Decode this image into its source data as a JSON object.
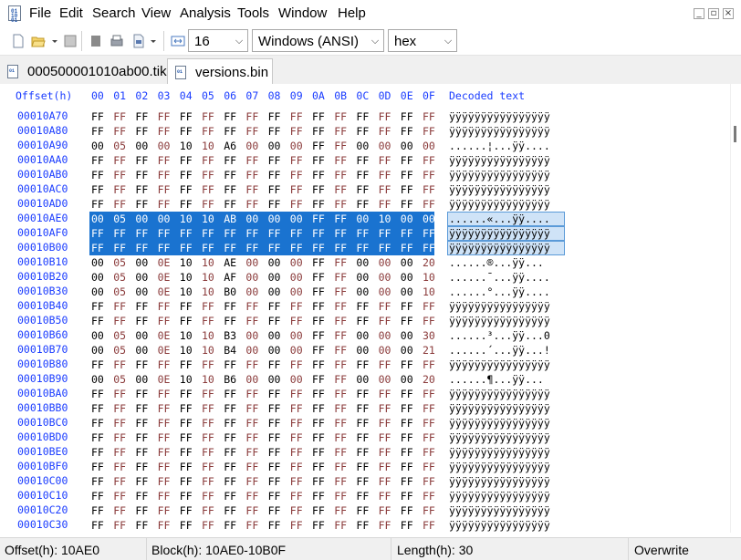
{
  "menu": [
    "File",
    "Edit",
    "Search",
    "View",
    "Analysis",
    "Tools",
    "Window",
    "Help"
  ],
  "toolbar": {
    "columns": "16",
    "charset": "Windows (ANSI)",
    "mode": "hex",
    "icons": [
      "new-file-icon",
      "open-folder-icon",
      "dropdown-arrow-icon",
      "save-icon",
      "save-all-icon",
      "print-icon",
      "export-icon",
      "dropdown-arrow-icon",
      "columns-icon"
    ]
  },
  "tabs": [
    {
      "label": "000500001010ab00.tik",
      "active": false
    },
    {
      "label": "versions.bin",
      "active": true
    }
  ],
  "header": {
    "offset": "Offset(h)",
    "cols": [
      "00",
      "01",
      "02",
      "03",
      "04",
      "05",
      "06",
      "07",
      "08",
      "09",
      "0A",
      "0B",
      "0C",
      "0D",
      "0E",
      "0F"
    ],
    "decoded": "Decoded text"
  },
  "rows": [
    {
      "offset": "00010A70",
      "bytes": "FF FF FF FF FF FF FF FF FF FF FF FF FF FF FF FF",
      "text": "ÿÿÿÿÿÿÿÿÿÿÿÿÿÿÿÿ"
    },
    {
      "offset": "00010A80",
      "bytes": "FF FF FF FF FF FF FF FF FF FF FF FF FF FF FF FF",
      "text": "ÿÿÿÿÿÿÿÿÿÿÿÿÿÿÿÿ"
    },
    {
      "offset": "00010A90",
      "bytes": "00 05 00 00 10 10 A6 00 00 00 FF FF 00 00 00 00",
      "text": "......¦...ÿÿ...."
    },
    {
      "offset": "00010AA0",
      "bytes": "FF FF FF FF FF FF FF FF FF FF FF FF FF FF FF FF",
      "text": "ÿÿÿÿÿÿÿÿÿÿÿÿÿÿÿÿ"
    },
    {
      "offset": "00010AB0",
      "bytes": "FF FF FF FF FF FF FF FF FF FF FF FF FF FF FF FF",
      "text": "ÿÿÿÿÿÿÿÿÿÿÿÿÿÿÿÿ"
    },
    {
      "offset": "00010AC0",
      "bytes": "FF FF FF FF FF FF FF FF FF FF FF FF FF FF FF FF",
      "text": "ÿÿÿÿÿÿÿÿÿÿÿÿÿÿÿÿ"
    },
    {
      "offset": "00010AD0",
      "bytes": "FF FF FF FF FF FF FF FF FF FF FF FF FF FF FF FF",
      "text": "ÿÿÿÿÿÿÿÿÿÿÿÿÿÿÿÿ"
    },
    {
      "offset": "00010AE0",
      "bytes": "00 05 00 00 10 10 AB 00 00 00 FF FF 00 10 00 00",
      "text": "......«...ÿÿ....",
      "selected": true
    },
    {
      "offset": "00010AF0",
      "bytes": "FF FF FF FF FF FF FF FF FF FF FF FF FF FF FF FF",
      "text": "ÿÿÿÿÿÿÿÿÿÿÿÿÿÿÿÿ",
      "selected": true
    },
    {
      "offset": "00010B00",
      "bytes": "FF FF FF FF FF FF FF FF FF FF FF FF FF FF FF FF",
      "text": "ÿÿÿÿÿÿÿÿÿÿÿÿÿÿÿÿ",
      "selected": true
    },
    {
      "offset": "00010B10",
      "bytes": "00 05 00 0E 10 10 AE 00 00 00 FF FF 00 00 00 20",
      "text": "......®...ÿÿ... "
    },
    {
      "offset": "00010B20",
      "bytes": "00 05 00 0E 10 10 AF 00 00 00 FF FF 00 00 00 10",
      "text": "......¯...ÿÿ...."
    },
    {
      "offset": "00010B30",
      "bytes": "00 05 00 0E 10 10 B0 00 00 00 FF FF 00 00 00 10",
      "text": "......°...ÿÿ...."
    },
    {
      "offset": "00010B40",
      "bytes": "FF FF FF FF FF FF FF FF FF FF FF FF FF FF FF FF",
      "text": "ÿÿÿÿÿÿÿÿÿÿÿÿÿÿÿÿ"
    },
    {
      "offset": "00010B50",
      "bytes": "FF FF FF FF FF FF FF FF FF FF FF FF FF FF FF FF",
      "text": "ÿÿÿÿÿÿÿÿÿÿÿÿÿÿÿÿ"
    },
    {
      "offset": "00010B60",
      "bytes": "00 05 00 0E 10 10 B3 00 00 00 FF FF 00 00 00 30",
      "text": "......³...ÿÿ...0"
    },
    {
      "offset": "00010B70",
      "bytes": "00 05 00 0E 10 10 B4 00 00 00 FF FF 00 00 00 21",
      "text": "......´...ÿÿ...!"
    },
    {
      "offset": "00010B80",
      "bytes": "FF FF FF FF FF FF FF FF FF FF FF FF FF FF FF FF",
      "text": "ÿÿÿÿÿÿÿÿÿÿÿÿÿÿÿÿ"
    },
    {
      "offset": "00010B90",
      "bytes": "00 05 00 0E 10 10 B6 00 00 00 FF FF 00 00 00 20",
      "text": "......¶...ÿÿ... "
    },
    {
      "offset": "00010BA0",
      "bytes": "FF FF FF FF FF FF FF FF FF FF FF FF FF FF FF FF",
      "text": "ÿÿÿÿÿÿÿÿÿÿÿÿÿÿÿÿ"
    },
    {
      "offset": "00010BB0",
      "bytes": "FF FF FF FF FF FF FF FF FF FF FF FF FF FF FF FF",
      "text": "ÿÿÿÿÿÿÿÿÿÿÿÿÿÿÿÿ"
    },
    {
      "offset": "00010BC0",
      "bytes": "FF FF FF FF FF FF FF FF FF FF FF FF FF FF FF FF",
      "text": "ÿÿÿÿÿÿÿÿÿÿÿÿÿÿÿÿ"
    },
    {
      "offset": "00010BD0",
      "bytes": "FF FF FF FF FF FF FF FF FF FF FF FF FF FF FF FF",
      "text": "ÿÿÿÿÿÿÿÿÿÿÿÿÿÿÿÿ"
    },
    {
      "offset": "00010BE0",
      "bytes": "FF FF FF FF FF FF FF FF FF FF FF FF FF FF FF FF",
      "text": "ÿÿÿÿÿÿÿÿÿÿÿÿÿÿÿÿ"
    },
    {
      "offset": "00010BF0",
      "bytes": "FF FF FF FF FF FF FF FF FF FF FF FF FF FF FF FF",
      "text": "ÿÿÿÿÿÿÿÿÿÿÿÿÿÿÿÿ"
    },
    {
      "offset": "00010C00",
      "bytes": "FF FF FF FF FF FF FF FF FF FF FF FF FF FF FF FF",
      "text": "ÿÿÿÿÿÿÿÿÿÿÿÿÿÿÿÿ"
    },
    {
      "offset": "00010C10",
      "bytes": "FF FF FF FF FF FF FF FF FF FF FF FF FF FF FF FF",
      "text": "ÿÿÿÿÿÿÿÿÿÿÿÿÿÿÿÿ"
    },
    {
      "offset": "00010C20",
      "bytes": "FF FF FF FF FF FF FF FF FF FF FF FF FF FF FF FF",
      "text": "ÿÿÿÿÿÿÿÿÿÿÿÿÿÿÿÿ"
    },
    {
      "offset": "00010C30",
      "bytes": "FF FF FF FF FF FF FF FF FF FF FF FF FF FF FF FF",
      "text": "ÿÿÿÿÿÿÿÿÿÿÿÿÿÿÿÿ"
    }
  ],
  "status": {
    "offset": "Offset(h): 10AE0",
    "block": "Block(h): 10AE0-10B0F",
    "length": "Length(h): 30",
    "mode": "Overwrite"
  },
  "colors": {
    "offset_blue": "#1a3cff",
    "selection_blue": "#1a73d0",
    "even_col": "#000000",
    "odd_col": "#8a3a3a"
  }
}
